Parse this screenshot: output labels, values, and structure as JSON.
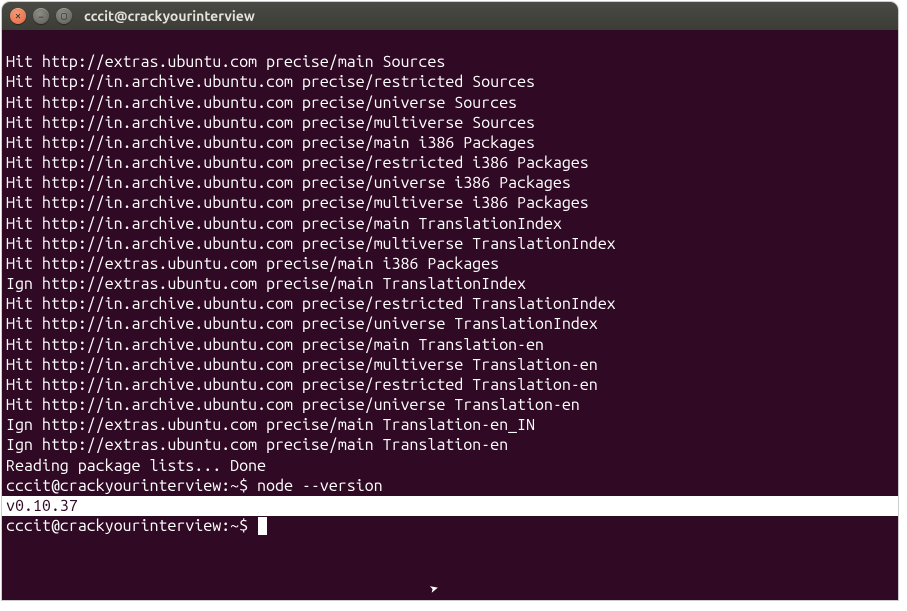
{
  "window": {
    "title": "cccit@crackyourinterview"
  },
  "terminal": {
    "lines": [
      "Hit http://extras.ubuntu.com precise/main Sources",
      "Hit http://in.archive.ubuntu.com precise/restricted Sources",
      "Hit http://in.archive.ubuntu.com precise/universe Sources",
      "Hit http://in.archive.ubuntu.com precise/multiverse Sources",
      "Hit http://in.archive.ubuntu.com precise/main i386 Packages",
      "Hit http://in.archive.ubuntu.com precise/restricted i386 Packages",
      "Hit http://in.archive.ubuntu.com precise/universe i386 Packages",
      "Hit http://in.archive.ubuntu.com precise/multiverse i386 Packages",
      "Hit http://in.archive.ubuntu.com precise/main TranslationIndex",
      "Hit http://in.archive.ubuntu.com precise/multiverse TranslationIndex",
      "Hit http://extras.ubuntu.com precise/main i386 Packages",
      "Ign http://extras.ubuntu.com precise/main TranslationIndex",
      "Hit http://in.archive.ubuntu.com precise/restricted TranslationIndex",
      "Hit http://in.archive.ubuntu.com precise/universe TranslationIndex",
      "Hit http://in.archive.ubuntu.com precise/main Translation-en",
      "Hit http://in.archive.ubuntu.com precise/multiverse Translation-en",
      "Hit http://in.archive.ubuntu.com precise/restricted Translation-en",
      "Hit http://in.archive.ubuntu.com precise/universe Translation-en",
      "Ign http://extras.ubuntu.com precise/main Translation-en_IN",
      "Ign http://extras.ubuntu.com precise/main Translation-en",
      "Reading package lists... Done"
    ],
    "prompt1": {
      "userhost": "cccit@crackyourinterview",
      "path": "~",
      "symbol": "$",
      "command": "node --version"
    },
    "output_highlight": "v0.10.37",
    "prompt2": {
      "userhost": "cccit@crackyourinterview",
      "path": "~",
      "symbol": "$",
      "command": ""
    }
  }
}
